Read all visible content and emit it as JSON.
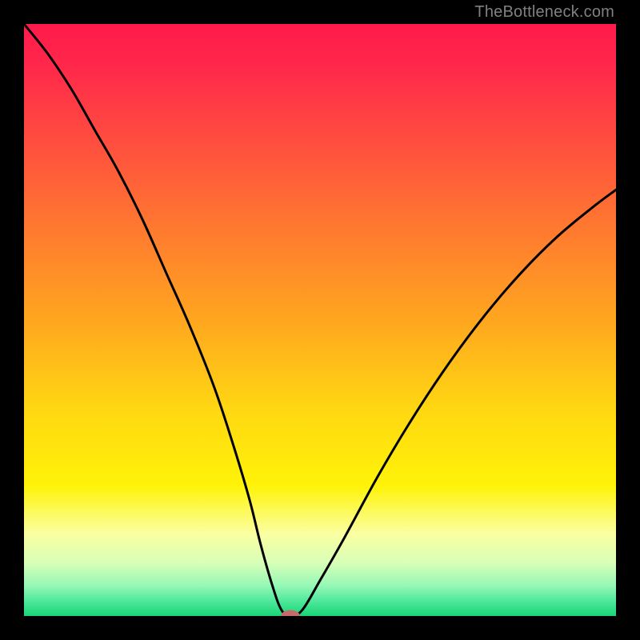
{
  "watermark": "TheBottleneck.com",
  "chart_data": {
    "type": "line",
    "title": "",
    "xlabel": "",
    "ylabel": "",
    "xlim": [
      0,
      100
    ],
    "ylim": [
      0,
      100
    ],
    "grid": false,
    "legend": false,
    "series": [
      {
        "name": "bottleneck-curve",
        "x": [
          0,
          4,
          8,
          12,
          16,
          20,
          24,
          28,
          32,
          35,
          38,
          40,
          42,
          43.5,
          45,
          47,
          50,
          54,
          60,
          66,
          72,
          78,
          84,
          90,
          96,
          100
        ],
        "y": [
          100,
          95,
          89,
          82,
          75,
          67,
          58,
          49,
          39,
          30,
          20,
          12,
          5,
          1,
          0,
          1,
          6,
          13,
          24,
          34,
          43,
          51,
          58,
          64,
          69,
          72
        ]
      }
    ],
    "marker": {
      "x": 45,
      "y": 0,
      "rx": 1.6,
      "ry": 1.0,
      "color": "#c96a6a"
    },
    "gradient_stops": [
      {
        "offset": 0,
        "color": "#ff1a4b"
      },
      {
        "offset": 0.08,
        "color": "#ff2a4a"
      },
      {
        "offset": 0.2,
        "color": "#ff4e3f"
      },
      {
        "offset": 0.35,
        "color": "#ff7a2f"
      },
      {
        "offset": 0.5,
        "color": "#ffa61f"
      },
      {
        "offset": 0.65,
        "color": "#ffd712"
      },
      {
        "offset": 0.78,
        "color": "#fff308"
      },
      {
        "offset": 0.86,
        "color": "#fbffa0"
      },
      {
        "offset": 0.91,
        "color": "#d8ffb8"
      },
      {
        "offset": 0.95,
        "color": "#93f7b6"
      },
      {
        "offset": 0.975,
        "color": "#4de89a"
      },
      {
        "offset": 1.0,
        "color": "#18d676"
      }
    ]
  }
}
